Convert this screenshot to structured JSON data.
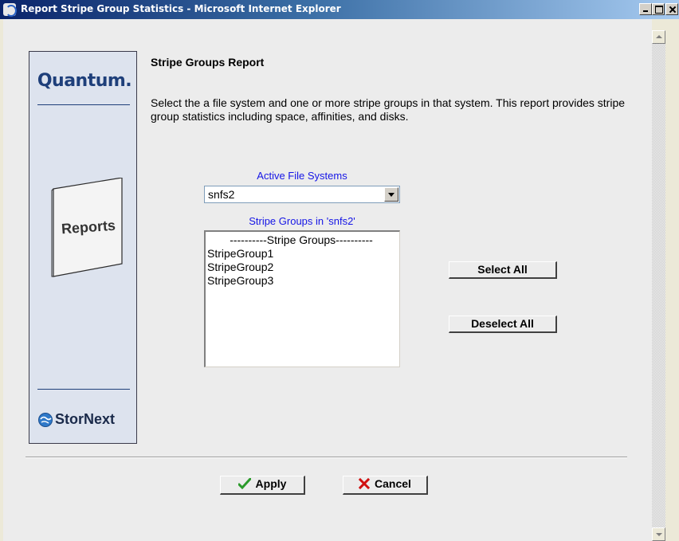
{
  "window": {
    "title": "Report Stripe Group Statistics - Microsoft Internet Explorer",
    "minimize_icon": "minimize-icon",
    "maximize_icon": "maximize-icon",
    "close_icon": "close-icon"
  },
  "sidebar": {
    "brand": "Quantum.",
    "section": "Reports",
    "product": "StorNext",
    "product_icon": "storenext-globe-icon"
  },
  "main": {
    "title": "Stripe Groups Report",
    "description": "Select the a file system and one or more stripe groups in that system. This report provides stripe group statistics including space, affinities, and disks.",
    "file_systems_label": "Active File Systems",
    "file_system_selected": "snfs2",
    "stripe_groups_label": "Stripe Groups in 'snfs2'",
    "stripe_groups": [
      "----------Stripe Groups----------",
      "StripeGroup1",
      "StripeGroup2",
      "StripeGroup3"
    ],
    "select_all_label": "Select All",
    "deselect_all_label": "Deselect All"
  },
  "footer": {
    "apply_label": "Apply",
    "apply_icon": "checkmark-icon",
    "cancel_label": "Cancel",
    "cancel_icon": "x-icon"
  },
  "colors": {
    "accent_blue": "#1515e6",
    "brand_blue": "#1e3f7a",
    "apply_green": "#2a9a2a",
    "cancel_red": "#d01010"
  }
}
